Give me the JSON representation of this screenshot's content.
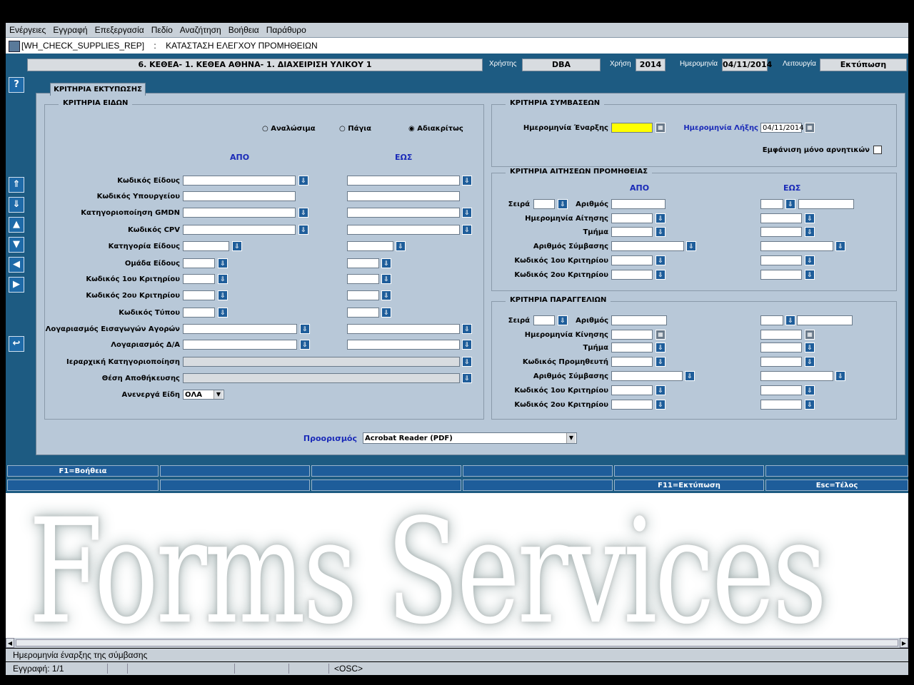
{
  "menu": [
    "Ενέργειες",
    "Εγγραφή",
    "Επεξεργασία",
    "Πεδίο",
    "Αναζήτηση",
    "Βοήθεια",
    "Παράθυρο"
  ],
  "window": {
    "form_id": "[WH_CHECK_SUPPLIES_REP]",
    "separator": ":",
    "form_title": "ΚΑΤΑΣΤΑΣΗ ΕΛΕΓΧΟΥ ΠΡΟΜΗΘΕΙΩΝ"
  },
  "info": {
    "org": "6. ΚΕΘΕΑ- 1. ΚΕΘΕΑ ΑΘΗΝΑ- 1. ΔΙΑΧΕΙΡΙΣΗ ΥΛΙΚΟΥ 1",
    "user_label": "Χρήστης",
    "user": "DBA",
    "year_label": "Χρήση",
    "year": "2014",
    "date_label": "Ημερομηνία",
    "date": "04/11/2014",
    "mode_label": "Λειτουργία",
    "mode": "Εκτύπωση"
  },
  "toolbar": {
    "help": "?",
    "first": "⇑",
    "last": "⇓",
    "prev": "▲",
    "next": "▼",
    "left": "◀",
    "right": "▶",
    "back": "↩"
  },
  "tab_label": "ΚΡΙΤΗΡΙΑ ΕΚΤΥΠΩΣΗΣ",
  "items": {
    "title": "ΚΡΙΤΗΡΙΑ ΕΙΔΩΝ",
    "radios": [
      "Αναλώσιμα",
      "Πάγια",
      "Αδιακρίτως"
    ],
    "from": "ΑΠΟ",
    "to": "ΕΩΣ",
    "labels": [
      "Κωδικός Είδους",
      "Κωδικός Υπουργείου",
      "Κατηγοριοποίηση GMDN",
      "Κωδικός CPV",
      "Κατηγορία Είδους",
      "Ομάδα Είδους",
      "Κωδικός 1ου Κριτηρίου",
      "Κωδικός 2ου Κριτηρίου",
      "Κωδικός Τύπου",
      "Λογαριασμός Εισαγωγών Αγορών",
      "Λογαριασμός Δ/Α",
      "Ιεραρχική Κατηγοριοποίηση",
      "Θέση Αποθήκευσης",
      "Ανενεργά Είδη"
    ],
    "inactive_value": "ΟΛΑ"
  },
  "contracts": {
    "title": "ΚΡΙΤΗΡΙΑ ΣΥΜΒΑΣΕΩΝ",
    "start_label": "Ημερομηνία Έναρξης",
    "start_value": "",
    "end_label": "Ημερομηνία Λήξης",
    "end_value": "04/11/2014",
    "negatives_label": "Εμφάνιση μόνο αρνητικών"
  },
  "requests": {
    "title": "ΚΡΙΤΗΡΙΑ ΑΙΤΗΣΕΩΝ ΠΡΟΜΗΘΕΙΑΣ",
    "from": "ΑΠΟ",
    "to": "ΕΩΣ",
    "series_label": "Σειρά",
    "number_label": "Αριθμός",
    "labels": [
      "Ημερομηνία Αίτησης",
      "Τμήμα",
      "Αριθμός Σύμβασης",
      "Κωδικός 1ου Κριτηρίου",
      "Κωδικός 2ου Κριτηρίου"
    ]
  },
  "orders": {
    "title": "ΚΡΙΤΗΡΙΑ ΠΑΡΑΓΓΕΛΙΩΝ",
    "series_label": "Σειρά",
    "number_label": "Αριθμός",
    "labels": [
      "Ημερομηνία Κίνησης",
      "Τμήμα",
      "Κωδικός Προμηθευτή",
      "Αριθμός Σύμβασης",
      "Κωδικός 1ου Κριτηρίου",
      "Κωδικός 2ου Κριτηρίου"
    ]
  },
  "destination": {
    "label": "Προορισμός",
    "value": "Acrobat Reader (PDF)"
  },
  "fkeys": {
    "help": "F1=Βοήθεια",
    "print": "F11=Εκτύπωση",
    "exit": "Esc=Τέλος"
  },
  "watermark": "Forms Services",
  "status": {
    "hint": "Ημερομηνία έναρξης της σύμβασης",
    "record": "Εγγραφή: 1/1",
    "osc": "<OSC>"
  },
  "colors": {
    "frame": "#1d5b82",
    "panel": "#b8c8d8",
    "highlight": "#ffff00"
  }
}
